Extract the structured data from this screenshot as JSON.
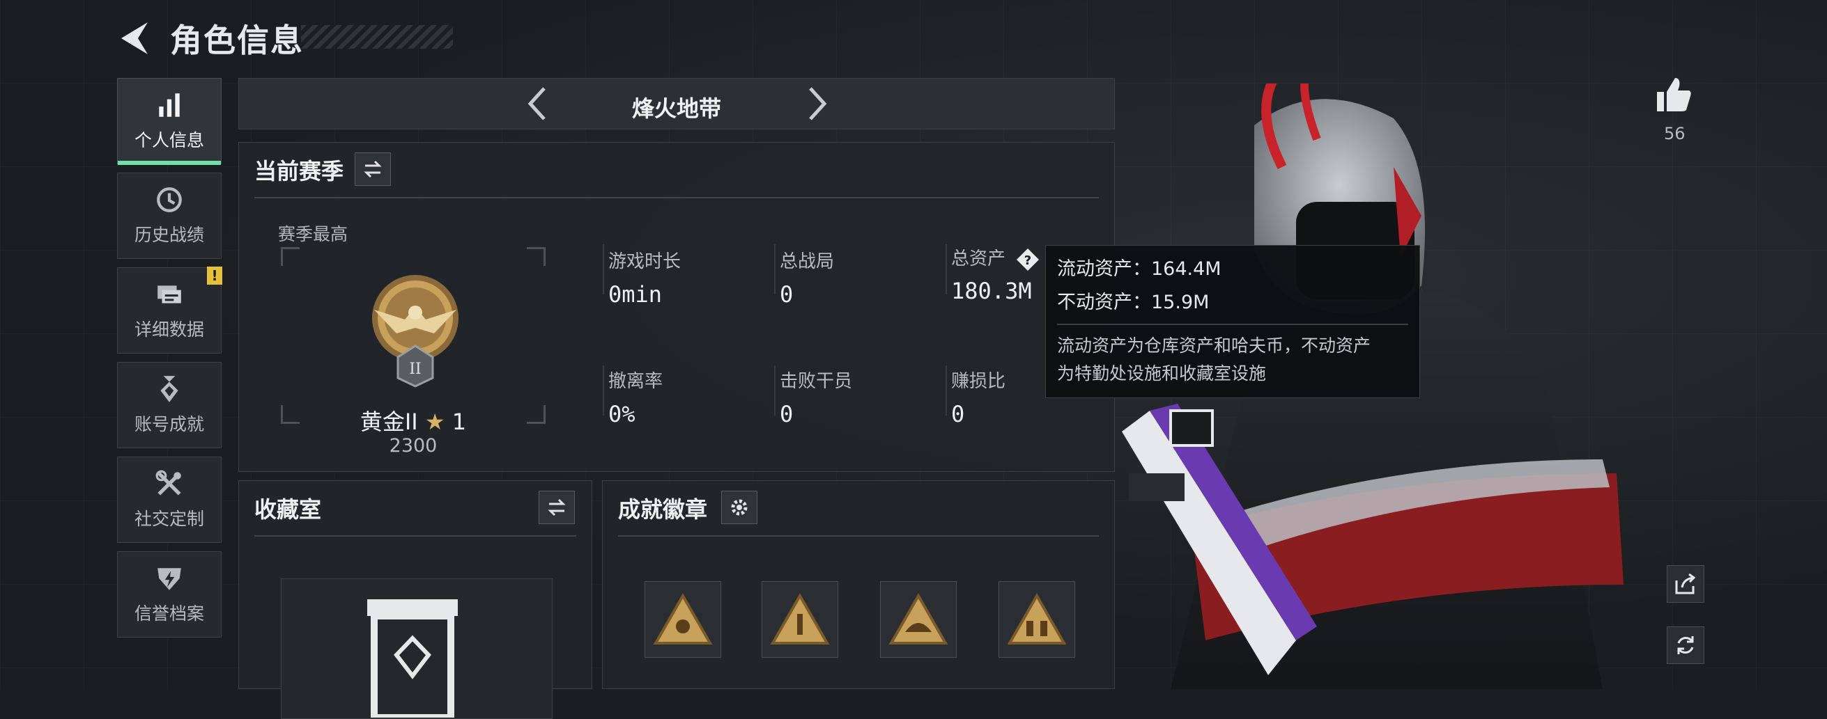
{
  "header": {
    "title": "角色信息"
  },
  "sidebar": {
    "items": [
      {
        "label": "个人信息",
        "icon": "bar-chart-icon",
        "active": true
      },
      {
        "label": "历史战绩",
        "icon": "history-clock-icon"
      },
      {
        "label": "详细数据",
        "icon": "folder-data-icon",
        "badge": "!"
      },
      {
        "label": "账号成就",
        "icon": "achievement-medal-icon"
      },
      {
        "label": "社交定制",
        "icon": "tools-icon"
      },
      {
        "label": "信誉档案",
        "icon": "shield-bolt-icon"
      }
    ]
  },
  "mode": {
    "title": "烽火地带"
  },
  "season": {
    "heading": "当前赛季",
    "season_high_label": "赛季最高",
    "rank_name": "黄金II",
    "rank_stars": "1",
    "rank_score": "2300",
    "stats": [
      {
        "label": "游戏时长",
        "value": "0min"
      },
      {
        "label": "总战局",
        "value": "0"
      },
      {
        "label": "总资产",
        "value": "180.3M",
        "has_help": true
      },
      {
        "label": "撤离率",
        "value": "0%"
      },
      {
        "label": "击败干员",
        "value": "0"
      },
      {
        "label": "赚损比",
        "value": "0"
      }
    ]
  },
  "tooltip": {
    "liquid": "流动资产：164.4M",
    "fixed": "不动资产：15.9M",
    "desc_line1": "流动资产为仓库资产和哈夫币，不动资产",
    "desc_line2": "为特勤处设施和收藏室设施"
  },
  "vault": {
    "heading": "收藏室"
  },
  "badges": {
    "heading": "成就徽章"
  },
  "social": {
    "like_count": "56"
  },
  "colors": {
    "accent": "#6fe0a8",
    "warning": "#e6c23c",
    "gold": "#c8a15a"
  }
}
